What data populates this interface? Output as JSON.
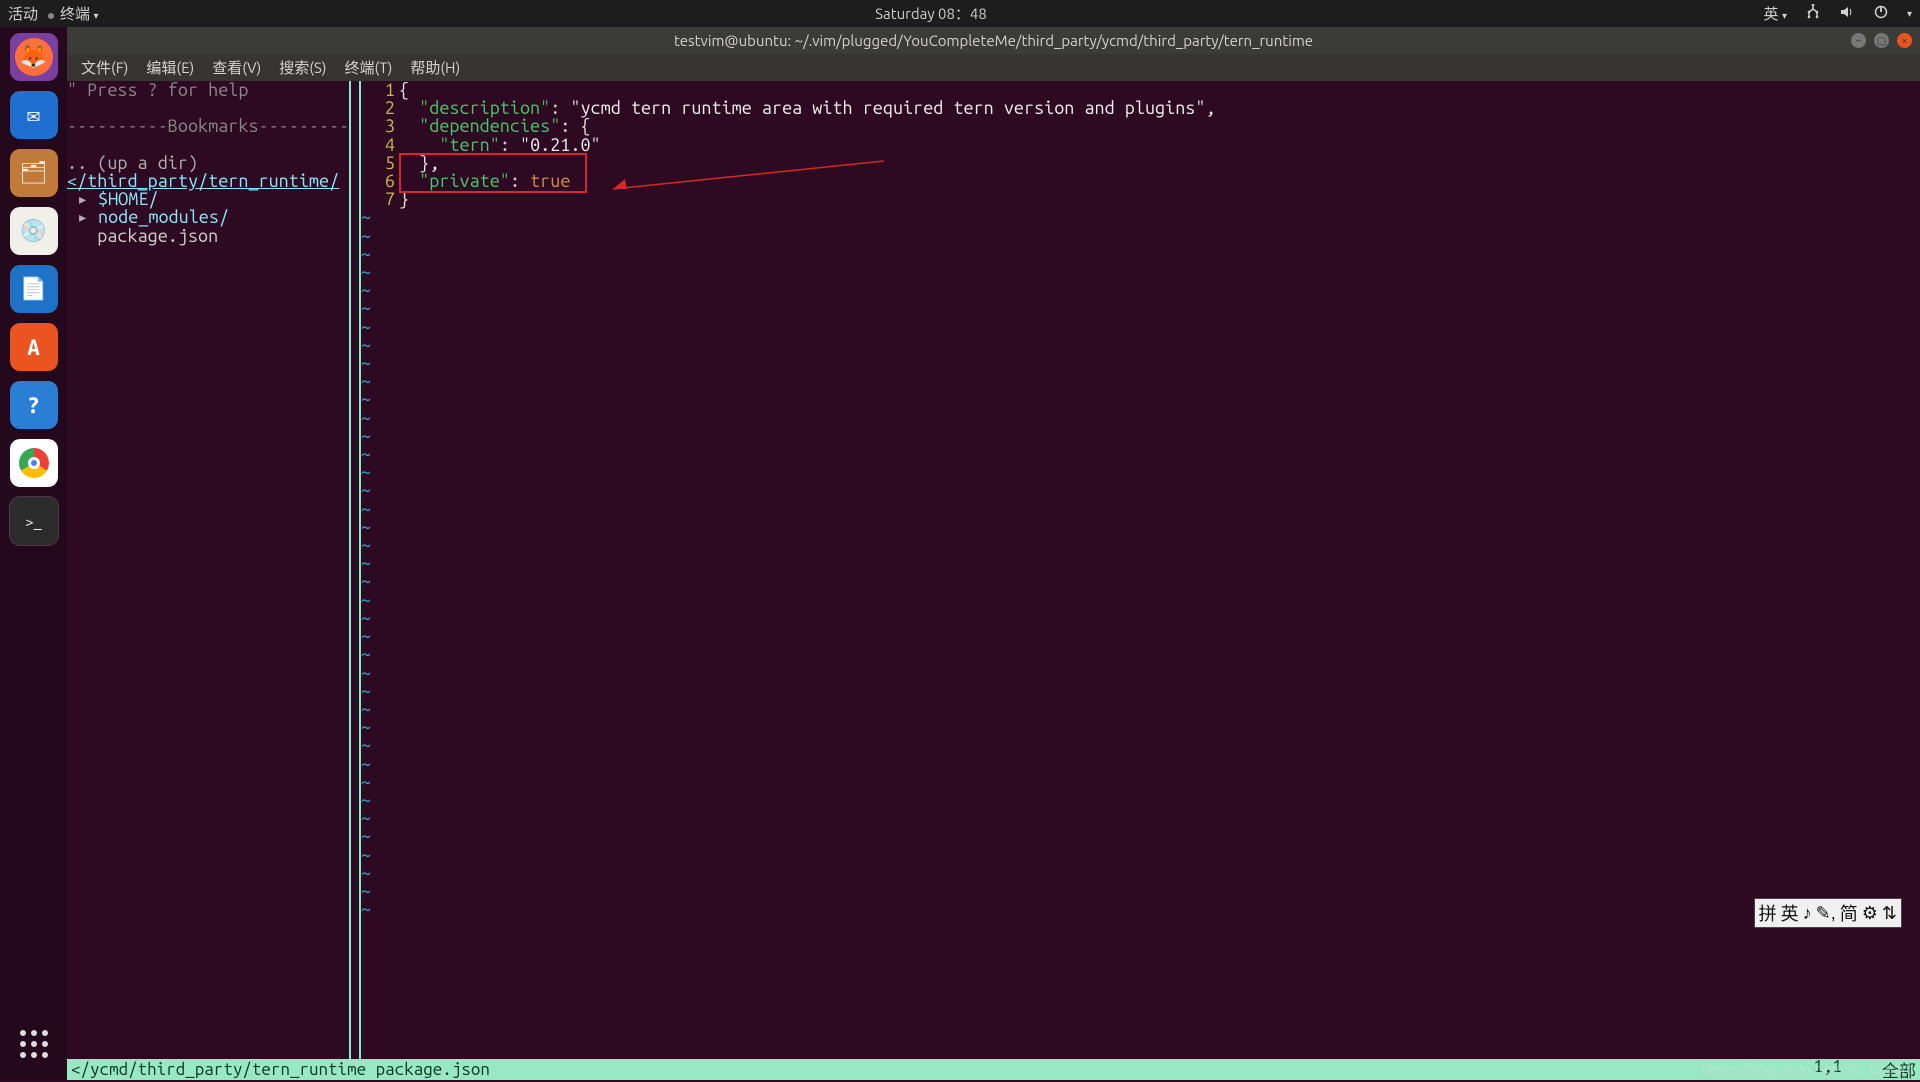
{
  "topbar": {
    "activities": "活动",
    "app": "终端",
    "clock": "Saturday 08：48",
    "input_lang": "英"
  },
  "window": {
    "title": "testvim@ubuntu: ~/.vim/plugged/YouCompleteMe/third_party/ycmd/third_party/tern_runtime"
  },
  "menu": {
    "file": "文件(F)",
    "edit": "编辑(E)",
    "view": "查看(V)",
    "search": "搜索(S)",
    "terminal": "终端(T)",
    "help": "帮助(H)"
  },
  "nerdtree": {
    "hint": "\" Press ? for help",
    "bookmarks": "----------Bookmarks----------",
    "updir": ".. (up a dir)",
    "root": "</third_party/tern_runtime/",
    "entries": [
      {
        "type": "dir",
        "name": "$HOME",
        "suffix": "/"
      },
      {
        "type": "dir",
        "name": "node_modules",
        "suffix": "/"
      },
      {
        "type": "file",
        "name": "package.json",
        "suffix": ""
      }
    ]
  },
  "code": {
    "lines": [
      {
        "n": "1",
        "raw": "{"
      },
      {
        "n": "2",
        "raw": "  \"description\": \"ycmd tern runtime area with required tern version and plugins\","
      },
      {
        "n": "3",
        "raw": "  \"dependencies\": {"
      },
      {
        "n": "4",
        "raw": "    \"tern\": \"0.21.0\""
      },
      {
        "n": "5",
        "raw": "  },"
      },
      {
        "n": "6",
        "raw": "  \"private\": true"
      },
      {
        "n": "7",
        "raw": "}"
      }
    ]
  },
  "status": {
    "path": "</ycmd/third_party/tern_runtime package.json",
    "pos": "1,1",
    "scroll": "全部"
  },
  "ime": {
    "items": [
      "拼",
      "英",
      "♪",
      "✎,",
      "简",
      "⚙",
      "⇅"
    ]
  },
  "watermark": "https://blog.csdn.net/iSs_Cream",
  "dock": {
    "items": [
      {
        "name": "firefox-icon",
        "color": "#ff7139",
        "glyph": "🦊"
      },
      {
        "name": "thunderbird-icon",
        "color": "#1f6fd0",
        "glyph": "✉"
      },
      {
        "name": "files-icon",
        "color": "#c07b3a",
        "glyph": "🗄"
      },
      {
        "name": "rhythmbox-icon",
        "color": "#f5f3ef",
        "glyph": "💿"
      },
      {
        "name": "writer-icon",
        "color": "#2072c9",
        "glyph": "📄"
      },
      {
        "name": "software-icon",
        "color": "#e95420",
        "glyph": "A"
      },
      {
        "name": "help-icon",
        "color": "#2a7fd5",
        "glyph": "?"
      },
      {
        "name": "chrome-icon",
        "color": "#ffffff",
        "glyph": "◉"
      },
      {
        "name": "terminal-icon",
        "color": "#2b2b2b",
        "glyph": ">_",
        "active": true
      }
    ]
  }
}
